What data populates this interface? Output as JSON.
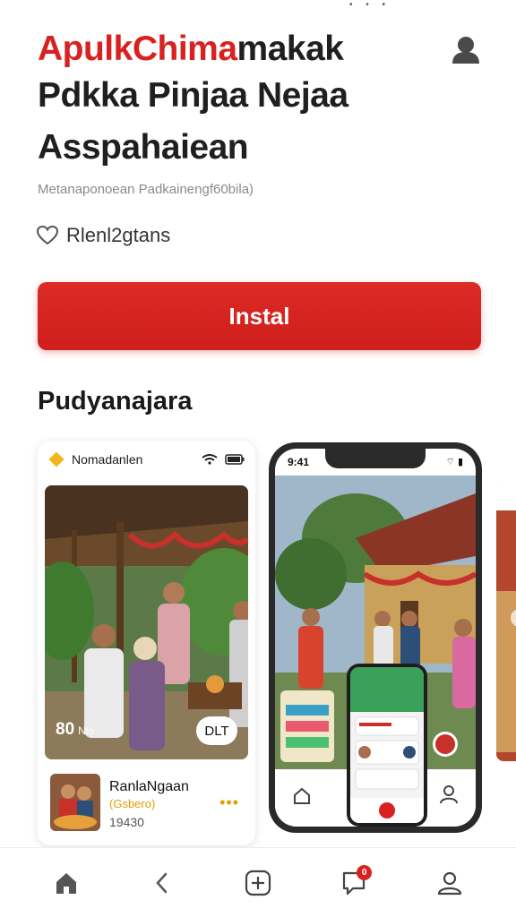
{
  "app": {
    "title_accent": "ApulkChima",
    "title_rest": "makak",
    "title_line2": "Pdkka Pinjaa Nejaa",
    "title_line3": "Asspahaiean",
    "subtitle": "Metanaponoean Padkainengf60bila)",
    "rating_text": "Rlenl2gtans",
    "install_label": "Instal"
  },
  "colors": {
    "accent": "#d82121",
    "yellow": "#e0a000"
  },
  "section": {
    "title": "Pudyanajara"
  },
  "card1": {
    "app_name": "Nomadanlen",
    "overlay_count": "80",
    "overlay_count_sub": "Nlo",
    "overlay_button": "DLT",
    "item_title": "RanlaNgaan",
    "item_sub": "(Gsbero)",
    "item_number": "19430",
    "more": "•••"
  },
  "card2": {
    "time": "9:41",
    "status": "⌔ ▮"
  },
  "nav": {
    "badge_count": "0"
  },
  "icons": {
    "avatar": "person-icon",
    "rating": "heart-icon",
    "home": "home-icon",
    "back": "chevron-left-icon",
    "add": "plus-square-icon",
    "notify": "bell-square-icon",
    "profile": "user-icon"
  }
}
